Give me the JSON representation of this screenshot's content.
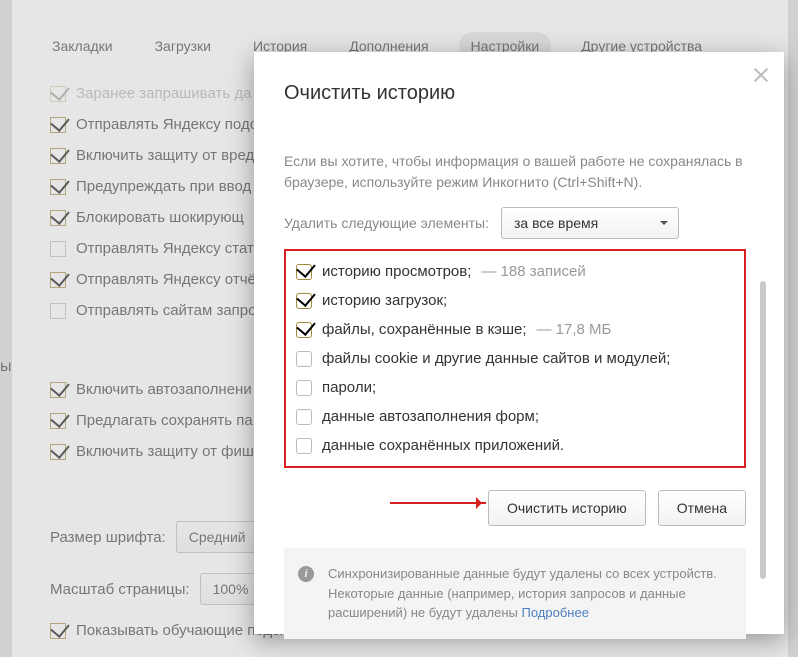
{
  "tabs": [
    "Закладки",
    "Загрузки",
    "История",
    "Дополнения",
    "Настройки",
    "Другие устройства"
  ],
  "activeTab": 4,
  "bgRows": [
    {
      "checked": true,
      "disabled": true,
      "label": "Заранее запрашивать да"
    },
    {
      "checked": true,
      "label": "Отправлять Яндексу подо"
    },
    {
      "checked": true,
      "label": "Включить защиту от вред"
    },
    {
      "checked": true,
      "label": "Предупреждать при ввод"
    },
    {
      "checked": true,
      "label": "Блокировать шокирующ"
    },
    {
      "checked": false,
      "label": "Отправлять Яндексу стати"
    },
    {
      "checked": true,
      "label": "Отправлять Яндексу отчё"
    },
    {
      "checked": false,
      "label": "Отправлять сайтам запро"
    }
  ],
  "bgRows2": [
    {
      "checked": true,
      "label": "Включить автозаполнени"
    },
    {
      "checked": true,
      "label": "Предлагать сохранять па"
    },
    {
      "checked": true,
      "label": "Включить защиту от фиши"
    }
  ],
  "form": {
    "fontLabel": "Размер шрифта:",
    "fontValue": "Средний",
    "zoomLabel": "Масштаб страницы:",
    "zoomValue": "100%"
  },
  "hintRow": {
    "checked": true,
    "label": "Показывать обучающие подсказки"
  },
  "sideChar": "ы",
  "modal": {
    "title": "Очистить историю",
    "intro": "Если вы хотите, чтобы информация о вашей работе не сохранялась в браузере, используйте режим Инкогнито (Ctrl+Shift+N).",
    "deleteLabel": "Удалить следующие элементы:",
    "period": "за все время",
    "items": [
      {
        "checked": true,
        "label": "историю просмотров;",
        "extra": "— 188 записей"
      },
      {
        "checked": true,
        "label": "историю загрузок;"
      },
      {
        "checked": true,
        "label": "файлы, сохранённые в кэше;",
        "extra": "— 17,8 МБ"
      },
      {
        "checked": false,
        "label": "файлы cookie и другие данные сайтов и модулей;"
      },
      {
        "checked": false,
        "label": "пароли;"
      },
      {
        "checked": false,
        "label": "данные автозаполнения форм;"
      },
      {
        "checked": false,
        "label": "данные сохранённых приложений."
      }
    ],
    "primaryBtn": "Очистить историю",
    "cancelBtn": "Отмена",
    "info": "Синхронизированные данные будут удалены со всех устройств. Некоторые данные (например, история запросов и данные расширений) не будут удалены",
    "infoLink": "Подробнее"
  }
}
